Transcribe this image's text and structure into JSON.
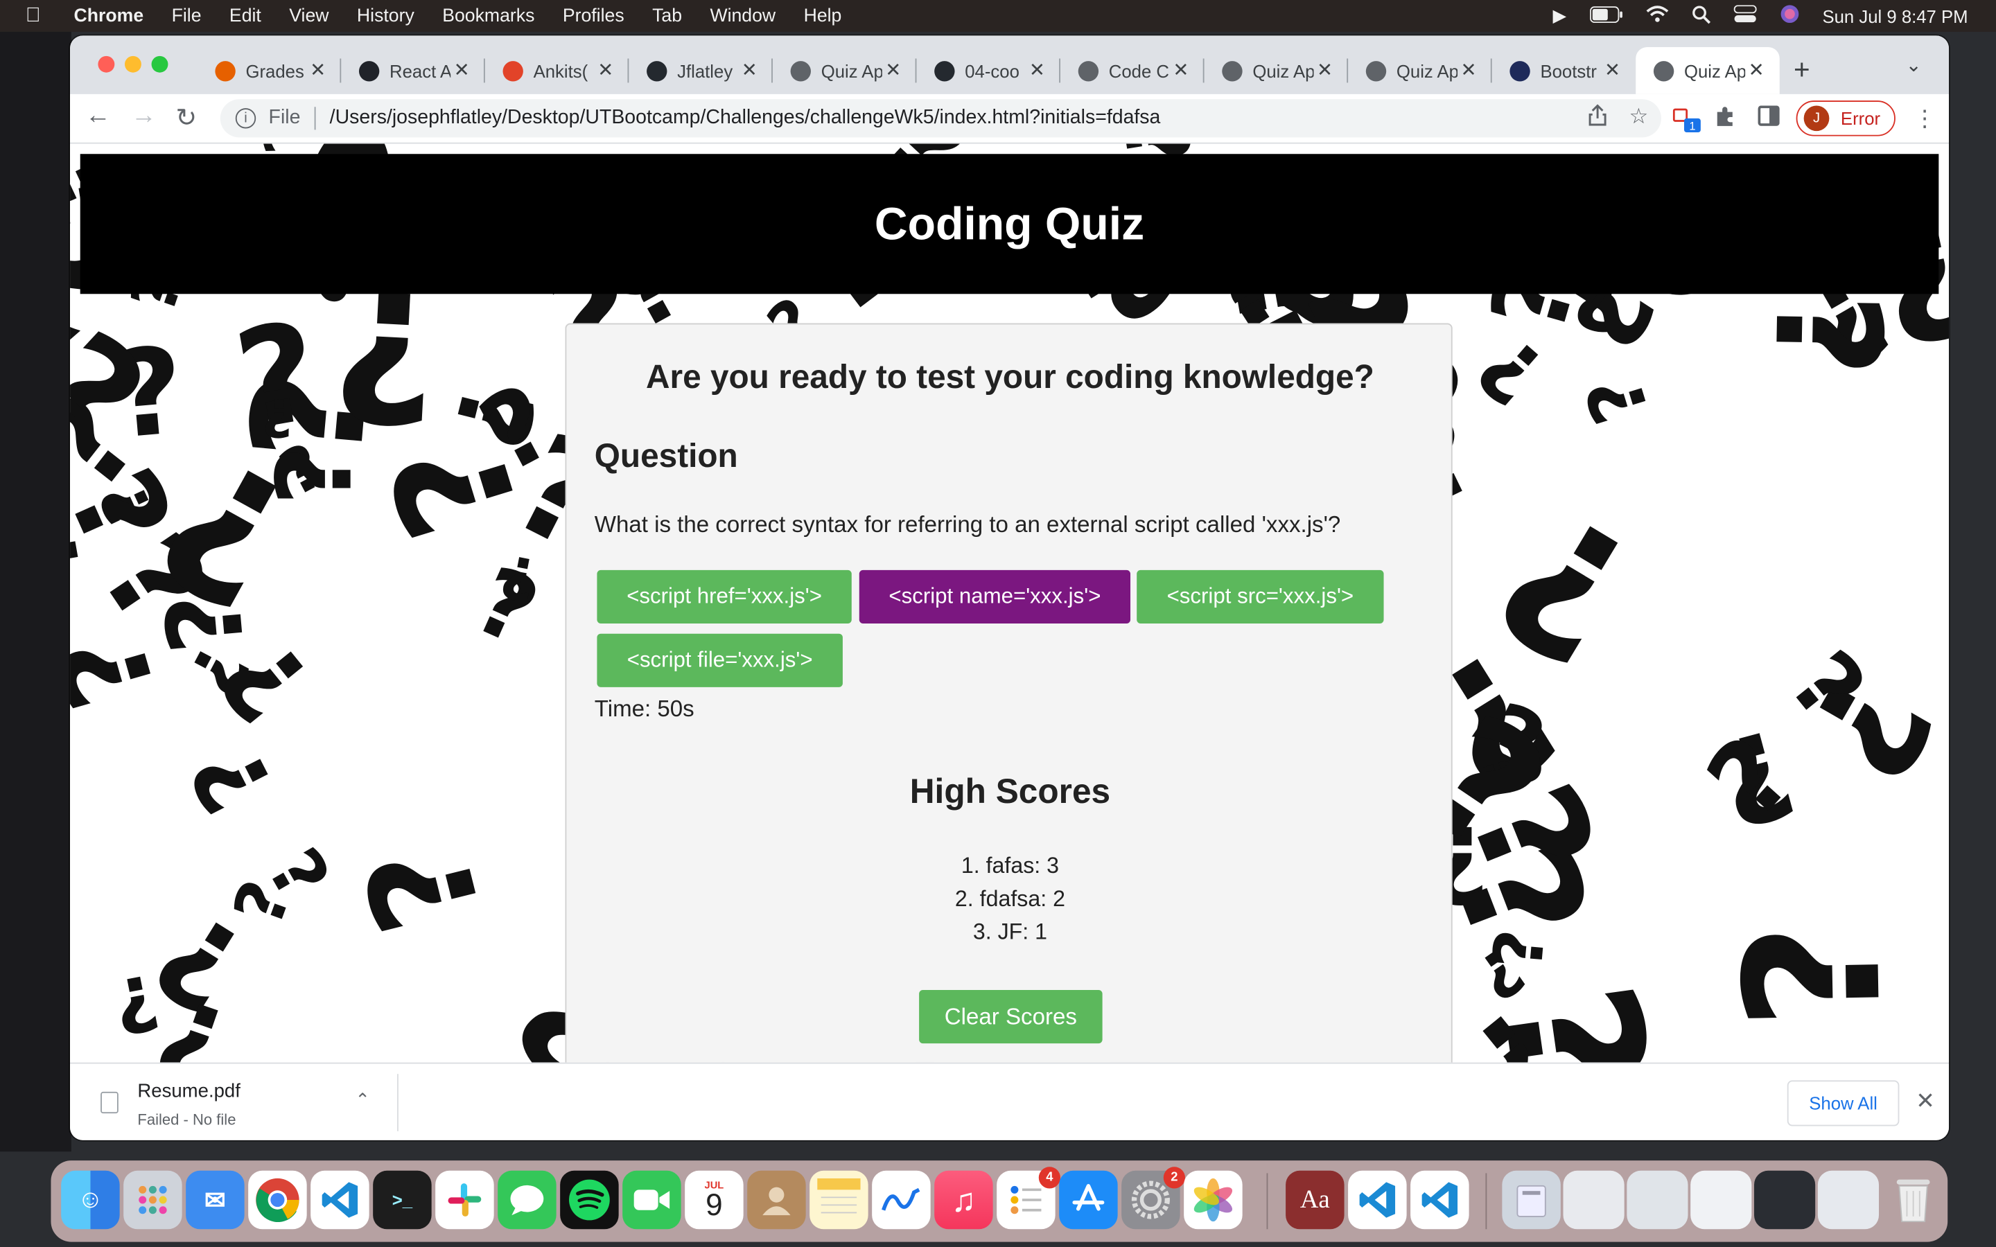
{
  "menubar": {
    "app": "Chrome",
    "items": [
      "File",
      "Edit",
      "View",
      "History",
      "Bookmarks",
      "Profiles",
      "Tab",
      "Window",
      "Help"
    ],
    "clock": "Sun Jul 9  8:47 PM"
  },
  "tabs": [
    {
      "label": "Grades",
      "icon": "canvas-icon",
      "color": "#e66000"
    },
    {
      "label": "React A",
      "icon": "react-icon",
      "color": "#20232a"
    },
    {
      "label": "Ankits(",
      "icon": "gitlab-icon",
      "color": "#e24329"
    },
    {
      "label": "Jflatley",
      "icon": "github-icon",
      "color": "#24292f"
    },
    {
      "label": "Quiz Ap",
      "icon": "globe-icon",
      "color": "#5f6368"
    },
    {
      "label": "04-coo",
      "icon": "github-icon",
      "color": "#24292f"
    },
    {
      "label": "Code C",
      "icon": "globe-icon",
      "color": "#5f6368"
    },
    {
      "label": "Quiz Ap",
      "icon": "globe-icon",
      "color": "#5f6368"
    },
    {
      "label": "Quiz Ap",
      "icon": "globe-icon",
      "color": "#5f6368"
    },
    {
      "label": "Bootstr",
      "icon": "bootstrap-icon",
      "color": "#1e2a5a"
    },
    {
      "label": "Quiz Ap",
      "icon": "globe-icon",
      "color": "#5f6368",
      "active": true
    }
  ],
  "toolbar": {
    "scheme": "File",
    "url": "/Users/josephflatley/Desktop/UTBootcamp/Challenges/challengeWk5/index.html?initials=fdafsa",
    "profile_initial": "J",
    "profile_status": "Error",
    "extension_badge": "1"
  },
  "page": {
    "title": "Coding Quiz",
    "intro": "Are you ready to test your coding knowledge?",
    "question_heading": "Question",
    "question_text": "What is the correct syntax for referring to an external script called 'xxx.js'?",
    "answers": [
      "<script href='xxx.js'>",
      "<script name='xxx.js'>",
      "<script src='xxx.js'>",
      "<script file='xxx.js'>"
    ],
    "timer": "Time: 50s",
    "highscores_heading": "High Scores",
    "scores": [
      "1. fafas: 3",
      "2. fdafsa: 2",
      "3. JF: 1"
    ],
    "clear_button": "Clear Scores",
    "colors": {
      "button": "#5cb85c",
      "button_hover": "#7b1780",
      "header": "#000000"
    }
  },
  "download_shelf": {
    "file_name": "Resume.pdf",
    "status": "Failed - No file",
    "show_all": "Show All"
  },
  "dock": {
    "calendar_month": "JUL",
    "calendar_day": "9",
    "reminders_badge": "4",
    "settings_badge": "2",
    "dictionary_label": "Aa"
  }
}
